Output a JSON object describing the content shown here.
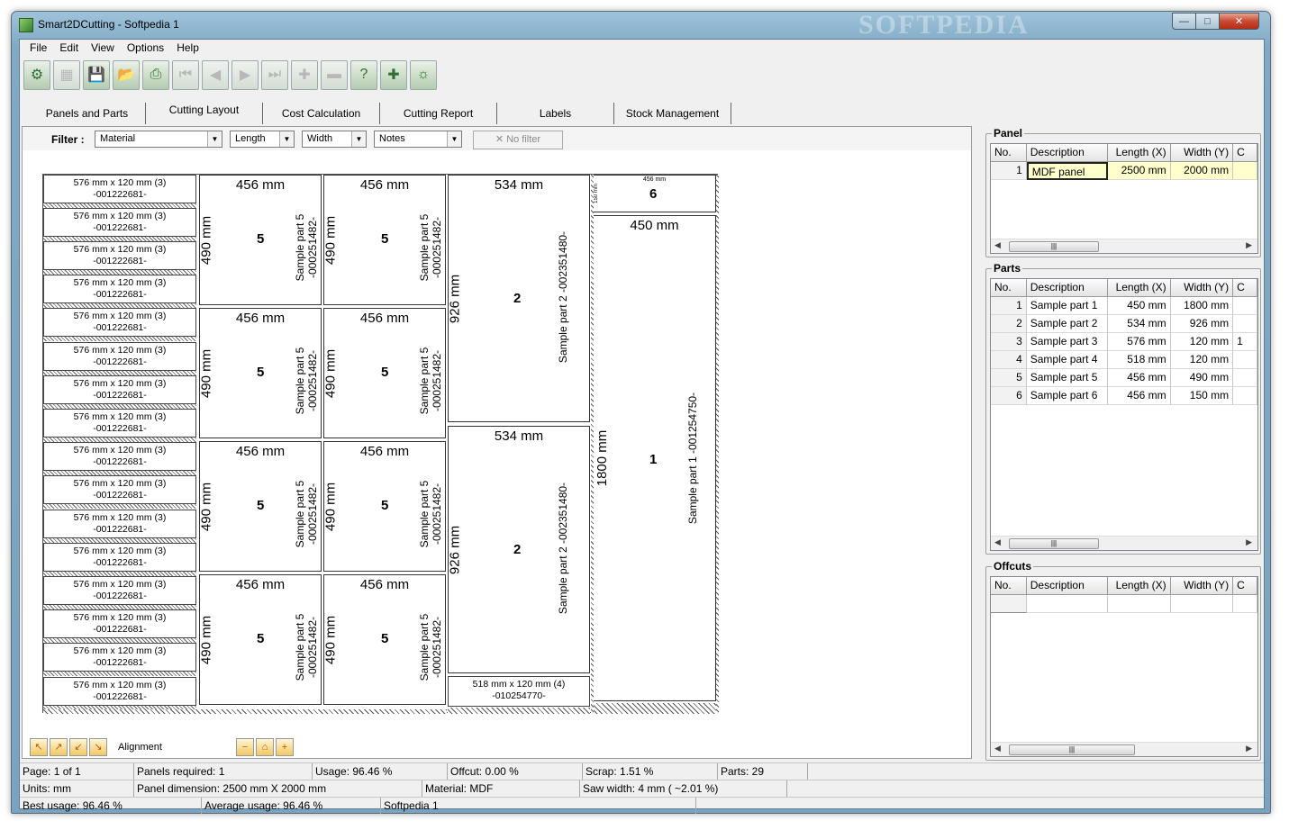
{
  "window": {
    "title": "Smart2DCutting - Softpedia 1",
    "watermark": "SOFTPEDIA"
  },
  "menu": [
    "File",
    "Edit",
    "View",
    "Options",
    "Help"
  ],
  "tabs": [
    "Panels and Parts",
    "Cutting Layout",
    "Cost Calculation",
    "Cutting Report",
    "Labels",
    "Stock Management"
  ],
  "tab_ghost": "SOFTPEDIA",
  "filter": {
    "label": "Filter :",
    "material": "Material",
    "length": "Length",
    "width": "Width",
    "notes": "Notes",
    "no_filter": "No filter"
  },
  "layout": {
    "strip_label": "576 mm x 120 mm (3)",
    "strip_code": "-001222681-",
    "strip_count": 16,
    "part5": {
      "w": "456 mm",
      "h": "490 mm",
      "num": "5",
      "label": "Sample part 5",
      "code": "-000251482-"
    },
    "part2": {
      "w": "534 mm",
      "h": "926 mm",
      "num": "2",
      "label": "Sample part 2  -002351480-"
    },
    "part6": {
      "w": "456 mm",
      "h": "150 mm",
      "num": "6"
    },
    "part1": {
      "w": "450 mm",
      "h": "1800 mm",
      "num": "1",
      "label": "Sample part 1  -001254750-"
    },
    "part4": {
      "label": "518 mm x 120 mm (4)",
      "code": "-010254770-"
    }
  },
  "alignment_label": "Alignment",
  "panel_group": {
    "title": "Panel",
    "columns": [
      "No.",
      "Description",
      "Length (X)",
      "Width (Y)",
      "C"
    ],
    "rows": [
      [
        "1",
        "MDF panel",
        "2500 mm",
        "2000 mm",
        ""
      ]
    ]
  },
  "parts_group": {
    "title": "Parts",
    "columns": [
      "No.",
      "Description",
      "Length (X)",
      "Width (Y)",
      "C"
    ],
    "rows": [
      [
        "1",
        "Sample part 1",
        "450 mm",
        "1800 mm",
        ""
      ],
      [
        "2",
        "Sample part 2",
        "534 mm",
        "926 mm",
        ""
      ],
      [
        "3",
        "Sample part 3",
        "576 mm",
        "120 mm",
        "1"
      ],
      [
        "4",
        "Sample part 4",
        "518 mm",
        "120 mm",
        ""
      ],
      [
        "5",
        "Sample part 5",
        "456 mm",
        "490 mm",
        ""
      ],
      [
        "6",
        "Sample part 6",
        "456 mm",
        "150 mm",
        ""
      ]
    ]
  },
  "offcuts_group": {
    "title": "Offcuts",
    "columns": [
      "No.",
      "Description",
      "Length (X)",
      "Width (Y)",
      "C"
    ]
  },
  "status": {
    "row1": [
      "Page: 1 of 1",
      "Panels required: 1",
      "Usage: 96.46 %",
      "Offcut: 0.00 %",
      "Scrap: 1.51 %",
      "Parts: 29"
    ],
    "row2": [
      "Units: mm",
      "Panel dimension: 2500 mm X 2000 mm",
      "Material: MDF",
      "Saw width: 4 mm   ( ~2.01 %)"
    ],
    "row3": [
      "Best usage: 96.46 %",
      "Average usage: 96.46 %",
      "Softpedia 1"
    ]
  }
}
